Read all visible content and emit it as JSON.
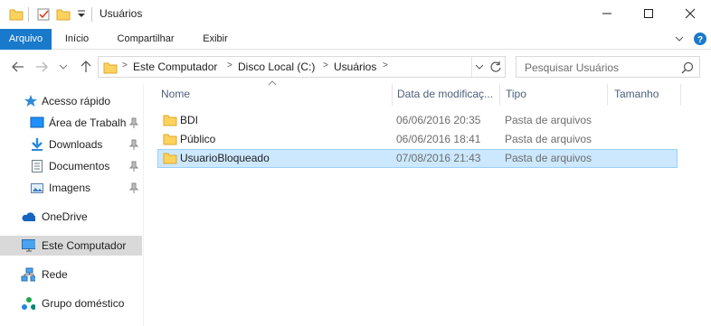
{
  "window": {
    "title": "Usuários"
  },
  "ribbon": {
    "tabs": [
      "Arquivo",
      "Início",
      "Compartilhar",
      "Exibir"
    ]
  },
  "address": {
    "crumbs": [
      "Este Computador",
      "Disco Local (C:)",
      "Usuários"
    ]
  },
  "search": {
    "placeholder": "Pesquisar Usuários"
  },
  "nav": {
    "items": [
      {
        "label": "Acesso rápido",
        "icon": "star-icon"
      },
      {
        "label": "Área de Trabalho",
        "icon": "desktop-icon"
      },
      {
        "label": "Downloads",
        "icon": "download-icon"
      },
      {
        "label": "Documentos",
        "icon": "documents-icon"
      },
      {
        "label": "Imagens",
        "icon": "pictures-icon"
      },
      {
        "label": "OneDrive",
        "icon": "cloud-icon"
      },
      {
        "label": "Este Computador",
        "icon": "computer-icon"
      },
      {
        "label": "Rede",
        "icon": "network-icon"
      },
      {
        "label": "Grupo doméstico",
        "icon": "homegroup-icon"
      }
    ]
  },
  "columns": {
    "name": "Nome",
    "date": "Data de modificaç...",
    "type": "Tipo",
    "size": "Tamanho"
  },
  "files": [
    {
      "name": "BDI",
      "date": "06/06/2016 20:35",
      "type": "Pasta de arquivos"
    },
    {
      "name": "Público",
      "date": "06/06/2016 18:41",
      "type": "Pasta de arquivos"
    },
    {
      "name": "UsuarioBloqueado",
      "date": "07/08/2016 21:43",
      "type": "Pasta de arquivos"
    }
  ],
  "colors": {
    "accent": "#1979ca",
    "selection_bg": "#cce8ff",
    "selection_border": "#99d1ff",
    "folder": "#ffd25e"
  }
}
